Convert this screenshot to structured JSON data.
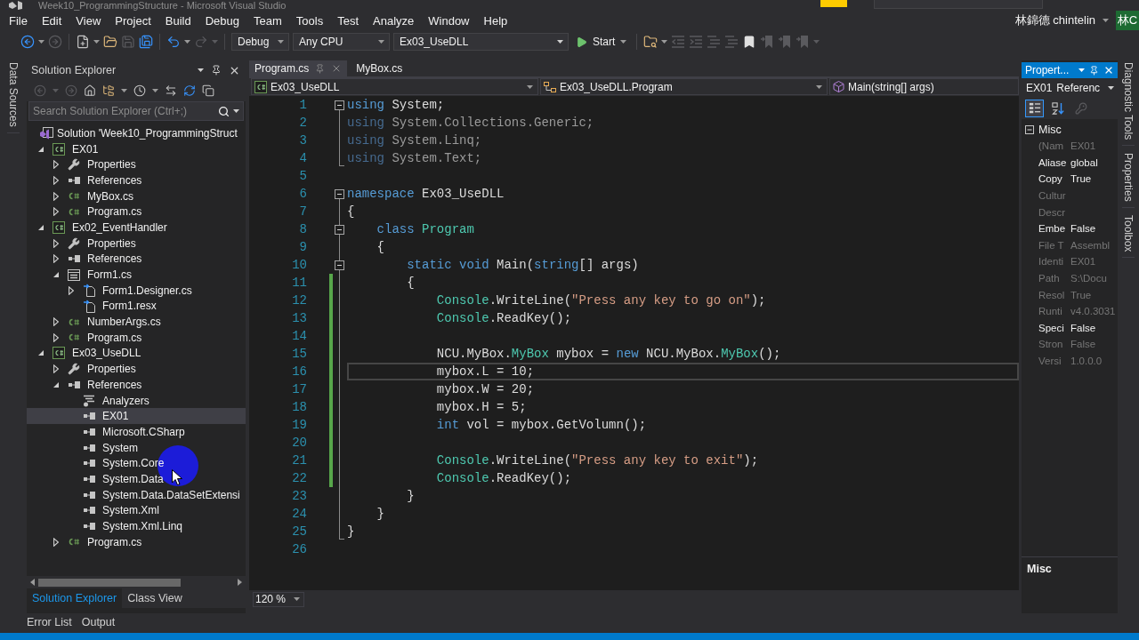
{
  "window": {
    "title": "Week10_ProgrammingStructure - Microsoft Visual Studio"
  },
  "menu": [
    "File",
    "Edit",
    "View",
    "Project",
    "Build",
    "Debug",
    "Team",
    "Tools",
    "Test",
    "Analyze",
    "Window",
    "Help"
  ],
  "account": {
    "name": "林錦德 chintelin",
    "avatar": "林C"
  },
  "toolbar": {
    "buttons": [
      {
        "kind": "back",
        "disabled": false
      },
      {
        "kind": "forward",
        "disabled": true
      },
      {
        "kind": "new-project",
        "disabled": false
      },
      {
        "kind": "open",
        "disabled": false
      },
      {
        "kind": "save",
        "disabled": true
      },
      {
        "kind": "save-all",
        "disabled": false
      },
      {
        "kind": "undo",
        "disabled": false
      },
      {
        "kind": "redo",
        "disabled": true
      }
    ],
    "configuration": "Debug",
    "platform": "Any CPU",
    "startup_project": "Ex03_UseDLL",
    "start": "Start",
    "more_buttons": [
      {
        "kind": "find-in-files",
        "disabled": false
      },
      {
        "kind": "outdent",
        "disabled": true
      },
      {
        "kind": "indent",
        "disabled": true
      },
      {
        "kind": "comment",
        "disabled": true
      },
      {
        "kind": "uncomment",
        "disabled": true
      },
      {
        "kind": "bookmark",
        "disabled": false
      },
      {
        "kind": "previous-bookmark",
        "disabled": true
      },
      {
        "kind": "next-bookmark",
        "disabled": true
      },
      {
        "kind": "clear-bookmarks",
        "disabled": true
      }
    ]
  },
  "left_tool_tabs": [
    "Data Sources"
  ],
  "solution_explorer": {
    "title": "Solution Explorer",
    "buttons": [
      {
        "kind": "back",
        "disabled": true
      },
      {
        "kind": "forward",
        "disabled": true
      },
      {
        "kind": "home",
        "disabled": false
      },
      {
        "kind": "switch-views",
        "disabled": false
      },
      {
        "kind": "pending-changes-filter",
        "disabled": false
      },
      {
        "kind": "sync",
        "disabled": false
      },
      {
        "kind": "refresh",
        "disabled": false
      },
      {
        "kind": "collapse-all",
        "disabled": false
      }
    ],
    "search": {
      "placeholder": "Search Solution Explorer (Ctrl+;)"
    },
    "tree": [
      {
        "kind": "solution",
        "label": "Solution 'Week10_ProgrammingStruct",
        "selected": false,
        "children": [
          {
            "kind": "project",
            "label": "EX01",
            "expanded": true,
            "selected": false,
            "children": [
              {
                "kind": "properties",
                "label": "Properties",
                "expanded": false,
                "selected": false
              },
              {
                "kind": "references",
                "label": "References",
                "expanded": false,
                "selected": false
              },
              {
                "kind": "csharp",
                "label": "MyBox.cs",
                "expanded": false,
                "selected": false
              },
              {
                "kind": "csharp",
                "label": "Program.cs",
                "expanded": false,
                "selected": false
              }
            ]
          },
          {
            "kind": "project",
            "label": "Ex02_EventHandler",
            "expanded": true,
            "selected": false,
            "children": [
              {
                "kind": "properties",
                "label": "Properties",
                "expanded": false,
                "selected": false
              },
              {
                "kind": "references",
                "label": "References",
                "expanded": false,
                "selected": false
              },
              {
                "kind": "form",
                "label": "Form1.cs",
                "expanded": true,
                "selected": false,
                "children": [
                  {
                    "kind": "designer",
                    "label": "Form1.Designer.cs",
                    "expanded": false,
                    "selected": false
                  },
                  {
                    "kind": "resource",
                    "label": "Form1.resx",
                    "selected": false
                  }
                ]
              },
              {
                "kind": "csharp",
                "label": "NumberArgs.cs",
                "expanded": false,
                "selected": false
              },
              {
                "kind": "csharp",
                "label": "Program.cs",
                "expanded": false,
                "selected": false
              }
            ]
          },
          {
            "kind": "project",
            "label": "Ex03_UseDLL",
            "expanded": true,
            "selected": false,
            "children": [
              {
                "kind": "properties",
                "label": "Properties",
                "expanded": false,
                "selected": false
              },
              {
                "kind": "references",
                "label": "References",
                "expanded": true,
                "selected": false,
                "children": [
                  {
                    "kind": "analyzers",
                    "label": "Analyzers",
                    "selected": false
                  },
                  {
                    "kind": "reference",
                    "label": "EX01",
                    "selected": true
                  },
                  {
                    "kind": "reference",
                    "label": "Microsoft.CSharp",
                    "selected": false
                  },
                  {
                    "kind": "reference",
                    "label": "System",
                    "selected": false
                  },
                  {
                    "kind": "reference",
                    "label": "System.Core",
                    "selected": false
                  },
                  {
                    "kind": "reference",
                    "label": "System.Data",
                    "selected": false
                  },
                  {
                    "kind": "reference",
                    "label": "System.Data.DataSetExtensi",
                    "selected": false
                  },
                  {
                    "kind": "reference",
                    "label": "System.Xml",
                    "selected": false
                  },
                  {
                    "kind": "reference",
                    "label": "System.Xml.Linq",
                    "selected": false
                  }
                ]
              },
              {
                "kind": "csharp",
                "label": "Program.cs",
                "expanded": false,
                "selected": false
              }
            ]
          }
        ]
      }
    ],
    "tabs": [
      {
        "label": "Solution Explorer",
        "selected": true
      },
      {
        "label": "Class View",
        "selected": false
      }
    ]
  },
  "editor": {
    "tabs": [
      {
        "label": "Program.cs",
        "selected": true
      },
      {
        "label": "MyBox.cs",
        "selected": false
      }
    ],
    "navigation": {
      "project": "Ex03_UseDLL",
      "type": "Ex03_UseDLL.Program",
      "member": "Main(string[] args)"
    },
    "lines": [
      {
        "number": "1",
        "kind": "region-start",
        "changed": false,
        "current": false,
        "tokens": [
          {
            "kind": "keyword",
            "text": "using"
          },
          {
            "kind": "plain",
            "text": " System;"
          }
        ]
      },
      {
        "number": "2",
        "kind": "region-line",
        "changed": false,
        "current": false,
        "tokens": [
          {
            "kind": "unused-keyword",
            "text": "using"
          },
          {
            "kind": "unused",
            "text": " System.Collections.Generic;"
          }
        ]
      },
      {
        "number": "3",
        "kind": "region-line",
        "changed": false,
        "current": false,
        "tokens": [
          {
            "kind": "unused-keyword",
            "text": "using"
          },
          {
            "kind": "unused",
            "text": " System.Linq;"
          }
        ]
      },
      {
        "number": "4",
        "kind": "region-end",
        "changed": false,
        "current": false,
        "tokens": [
          {
            "kind": "unused-keyword",
            "text": "using"
          },
          {
            "kind": "unused",
            "text": " System.Text;"
          }
        ]
      },
      {
        "number": "5",
        "kind": "plain",
        "changed": false,
        "current": false
      },
      {
        "number": "6",
        "kind": "region-start",
        "changed": false,
        "current": false,
        "tokens": [
          {
            "kind": "keyword",
            "text": "namespace"
          },
          {
            "kind": "plain",
            "text": " Ex03_UseDLL"
          }
        ]
      },
      {
        "number": "7",
        "kind": "region-line",
        "changed": false,
        "current": false,
        "tokens": [
          {
            "kind": "plain",
            "text": "{"
          }
        ]
      },
      {
        "number": "8",
        "kind": "region-start",
        "changed": false,
        "current": false,
        "tokens": [
          {
            "kind": "keyword",
            "text": "    class"
          },
          {
            "kind": "type",
            "text": " Program"
          }
        ]
      },
      {
        "number": "9",
        "kind": "region-line",
        "changed": false,
        "current": false,
        "tokens": [
          {
            "kind": "plain",
            "text": "    {"
          }
        ]
      },
      {
        "number": "10",
        "kind": "region-start",
        "changed": false,
        "current": false,
        "tokens": [
          {
            "kind": "keyword",
            "text": "        static"
          },
          {
            "kind": "keyword",
            "text": " void"
          },
          {
            "kind": "plain",
            "text": " Main("
          },
          {
            "kind": "keyword",
            "text": "string"
          },
          {
            "kind": "plain",
            "text": "[] args)"
          }
        ]
      },
      {
        "number": "11",
        "kind": "region-line",
        "changed": true,
        "current": false,
        "tokens": [
          {
            "kind": "plain",
            "text": "        {"
          }
        ]
      },
      {
        "number": "12",
        "kind": "region-line",
        "changed": true,
        "current": false,
        "tokens": [
          {
            "kind": "type",
            "text": "            Console"
          },
          {
            "kind": "plain",
            "text": ".WriteLine("
          },
          {
            "kind": "string",
            "text": "\"Press any key to go on\""
          },
          {
            "kind": "plain",
            "text": ");"
          }
        ]
      },
      {
        "number": "13",
        "kind": "region-line",
        "changed": true,
        "current": false,
        "tokens": [
          {
            "kind": "type",
            "text": "            Console"
          },
          {
            "kind": "plain",
            "text": ".ReadKey();"
          }
        ]
      },
      {
        "number": "14",
        "kind": "region-line",
        "changed": true,
        "current": false
      },
      {
        "number": "15",
        "kind": "region-line",
        "changed": true,
        "current": false,
        "tokens": [
          {
            "kind": "plain",
            "text": "            NCU.MyBox."
          },
          {
            "kind": "type",
            "text": "MyBox"
          },
          {
            "kind": "plain",
            "text": " mybox = "
          },
          {
            "kind": "keyword",
            "text": "new"
          },
          {
            "kind": "plain",
            "text": " NCU.MyBox."
          },
          {
            "kind": "type",
            "text": "MyBox"
          },
          {
            "kind": "plain",
            "text": "();"
          }
        ]
      },
      {
        "number": "16",
        "kind": "region-line",
        "changed": true,
        "current": true,
        "tokens": [
          {
            "kind": "plain",
            "text": "            mybox.L = 10;"
          }
        ]
      },
      {
        "number": "17",
        "kind": "region-line",
        "changed": true,
        "current": false,
        "tokens": [
          {
            "kind": "plain",
            "text": "            mybox.W = 20;"
          }
        ]
      },
      {
        "number": "18",
        "kind": "region-line",
        "changed": true,
        "current": false,
        "tokens": [
          {
            "kind": "plain",
            "text": "            mybox.H = 5;"
          }
        ]
      },
      {
        "number": "19",
        "kind": "region-line",
        "changed": true,
        "current": false,
        "tokens": [
          {
            "kind": "keyword",
            "text": "            int"
          },
          {
            "kind": "plain",
            "text": " vol = mybox.GetVolumn();"
          }
        ]
      },
      {
        "number": "20",
        "kind": "region-line",
        "changed": true,
        "current": false
      },
      {
        "number": "21",
        "kind": "region-line",
        "changed": true,
        "current": false,
        "tokens": [
          {
            "kind": "type",
            "text": "            Console"
          },
          {
            "kind": "plain",
            "text": ".WriteLine("
          },
          {
            "kind": "string",
            "text": "\"Press any key to exit\""
          },
          {
            "kind": "plain",
            "text": ");"
          }
        ]
      },
      {
        "number": "22",
        "kind": "region-line",
        "changed": true,
        "current": false,
        "tokens": [
          {
            "kind": "type",
            "text": "            Console"
          },
          {
            "kind": "plain",
            "text": ".ReadKey();"
          }
        ]
      },
      {
        "number": "23",
        "kind": "region-line",
        "changed": false,
        "current": false,
        "tokens": [
          {
            "kind": "plain",
            "text": "        }"
          }
        ]
      },
      {
        "number": "24",
        "kind": "region-line",
        "changed": false,
        "current": false,
        "tokens": [
          {
            "kind": "plain",
            "text": "    }"
          }
        ]
      },
      {
        "number": "25",
        "kind": "region-end",
        "changed": false,
        "current": false,
        "tokens": [
          {
            "kind": "plain",
            "text": "}"
          }
        ]
      },
      {
        "number": "26",
        "kind": "plain",
        "changed": false,
        "current": false
      }
    ],
    "zoom": "120 %"
  },
  "properties": {
    "title": "Propert...",
    "object_name": "EX01",
    "object_type": "Referenc",
    "toolbar_buttons": [
      {
        "kind": "categorized",
        "selected": true,
        "disabled": false
      },
      {
        "kind": "alphabetical",
        "selected": false,
        "disabled": false
      },
      {
        "kind": "property-pages",
        "selected": false,
        "disabled": true
      }
    ],
    "categories": [
      {
        "name": "Misc",
        "expanded": true,
        "rows": [
          {
            "name": "(Nam",
            "value": "EX01",
            "readonly": true
          },
          {
            "name": "Aliase",
            "value": "global",
            "readonly": false
          },
          {
            "name": "Copy",
            "value": "True",
            "readonly": false
          },
          {
            "name": "Cultur",
            "readonly": true
          },
          {
            "name": "Descr",
            "readonly": true
          },
          {
            "name": "Embe",
            "value": "False",
            "readonly": false
          },
          {
            "name": "File T",
            "value": "Assembl",
            "readonly": true
          },
          {
            "name": "Identi",
            "value": "EX01",
            "readonly": true
          },
          {
            "name": "Path",
            "value": "S:\\Docu",
            "readonly": true
          },
          {
            "name": "Resol",
            "value": "True",
            "readonly": true
          },
          {
            "name": "Runti",
            "value": "v4.0.3031",
            "readonly": true
          },
          {
            "name": "Speci",
            "value": "False",
            "readonly": false
          },
          {
            "name": "Stron",
            "value": "False",
            "readonly": true
          },
          {
            "name": "Versi",
            "value": "1.0.0.0",
            "readonly": true
          }
        ]
      }
    ],
    "description_title": "Misc"
  },
  "right_tool_tabs": [
    "Diagnostic Tools",
    "Properties",
    "Toolbox"
  ],
  "bottom_tool_tabs": [
    "Error List",
    "Output"
  ]
}
